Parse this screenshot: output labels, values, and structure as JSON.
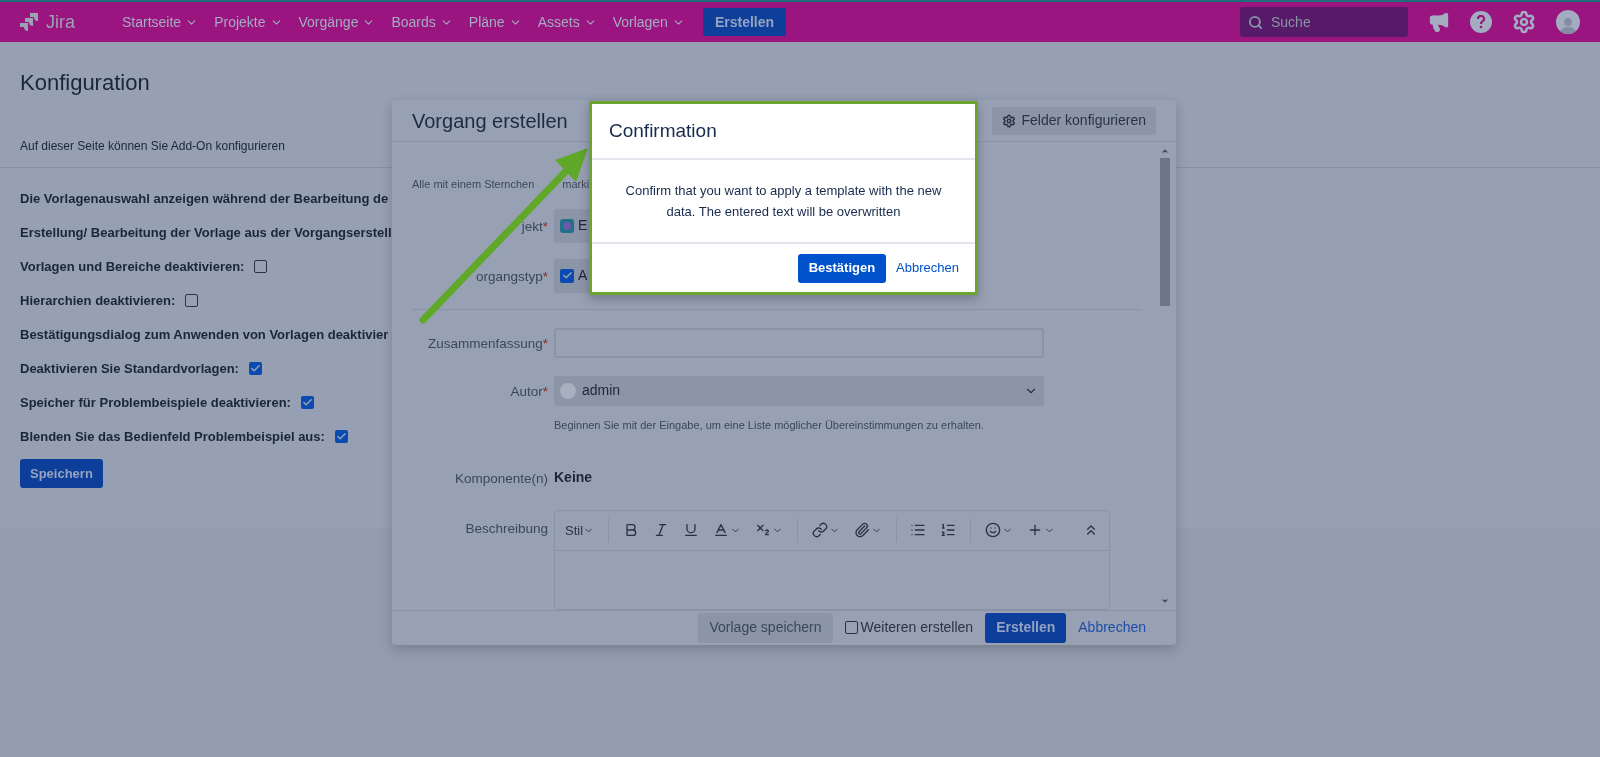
{
  "nav": {
    "logo": "Jira",
    "items": [
      {
        "label": "Startseite"
      },
      {
        "label": "Projekte"
      },
      {
        "label": "Vorgänge"
      },
      {
        "label": "Boards"
      },
      {
        "label": "Pläne"
      },
      {
        "label": "Assets"
      },
      {
        "label": "Vorlagen"
      }
    ],
    "create_button": "Erstellen",
    "search": {
      "placeholder": "Suche"
    }
  },
  "page": {
    "title": "Konfiguration",
    "description": "Auf dieser Seite können Sie Add-On konfigurieren",
    "settings": [
      {
        "kind": "text",
        "label": "Die Vorlagenauswahl anzeigen während der Bearbeitung de"
      },
      {
        "kind": "text",
        "label": "Erstellung/ Bearbeitung der Vorlage aus der Vorgangserstell"
      },
      {
        "kind": "checkbox",
        "label": "Vorlagen und Bereiche deaktivieren:",
        "checked": false
      },
      {
        "kind": "checkbox",
        "label": "Hierarchien deaktivieren:",
        "checked": false
      },
      {
        "kind": "text",
        "label": "Bestätigungsdialog zum Anwenden von Vorlagen deaktivier"
      },
      {
        "kind": "checkbox",
        "label": "Deaktivieren Sie Standardvorlagen:",
        "checked": true
      },
      {
        "kind": "checkbox",
        "label": "Speicher für Problembeispiele deaktivieren:",
        "checked": true
      },
      {
        "kind": "checkbox",
        "label": "Blenden Sie das Bedienfeld Problembeispiel aus:",
        "checked": true
      }
    ],
    "save_button": "Speichern"
  },
  "create_dialog": {
    "title": "Vorgang erstellen",
    "configure_fields_button": "Felder konfigurieren",
    "required_note": [
      "Alle mit einem Sternchen",
      "marki"
    ],
    "fields": [
      {
        "kind": "project",
        "label": "jekt",
        "mark": "*",
        "value": "E"
      },
      {
        "kind": "issuetype",
        "label": "organgstyp",
        "mark": "*",
        "value": "A"
      },
      {
        "kind": "text",
        "label": "Zusammenfassung",
        "mark": "*"
      },
      {
        "kind": "user",
        "label": "Autor",
        "mark": "*",
        "value": "admin",
        "hint": "Beginnen Sie mit der Eingabe, um eine Liste möglicher Übereinstimmungen zu erhalten."
      },
      {
        "kind": "static",
        "label": "Komponente(n)",
        "value": "Keine"
      },
      {
        "kind": "editor",
        "label": "Beschreibung",
        "style_menu": "Stil"
      }
    ],
    "footer": {
      "save_template": "Vorlage speichern",
      "create_another": {
        "label": "Weiteren erstellen",
        "checked": false
      },
      "submit": "Erstellen",
      "cancel": "Abbrechen"
    }
  },
  "confirmation": {
    "title": "Confirmation",
    "message": "Confirm that you want to apply a template with the new data. The entered text will be overwritten",
    "confirm": "Bestätigen",
    "cancel": "Abbrechen"
  }
}
